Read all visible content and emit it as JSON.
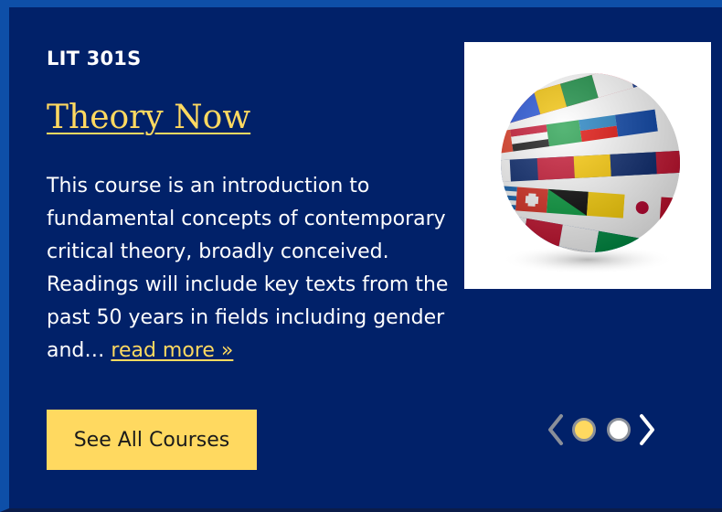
{
  "course": {
    "code": "LIT 301S",
    "title": "Theory Now",
    "description": "This course is an introduction to fundamental concepts of contemporary critical theory, broadly conceived. Readings will include key texts from the past 50 years in fields including gender and… ",
    "read_more": "read more »"
  },
  "image": {
    "icon": "flag-globe-icon"
  },
  "cta": {
    "label": "See All Courses"
  },
  "carousel": {
    "prev_icon": "chevron-left-icon",
    "next_icon": "chevron-right-icon",
    "slides": 2,
    "active_slide": 1
  },
  "colors": {
    "background": "#012169",
    "frame": "#0e4fa8",
    "accent": "#ffd960",
    "text": "#ffffff"
  }
}
